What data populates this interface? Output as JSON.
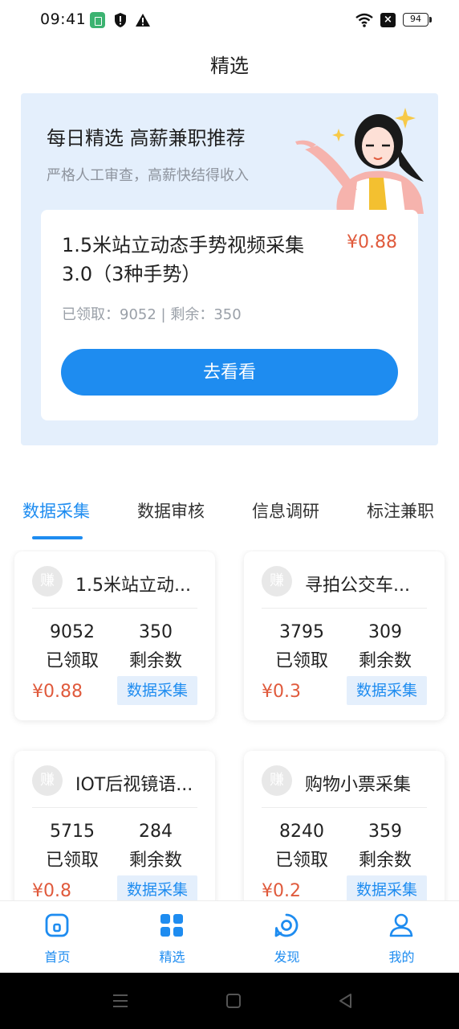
{
  "status_bar": {
    "time": "09:41",
    "battery": "94"
  },
  "page_title": "精选",
  "banner": {
    "title": "每日精选 高薪兼职推荐",
    "subtitle": "严格人工审查，高薪快结得收入",
    "featured_task": {
      "title": "1.5米站立动态手势视频采集3.0（3种手势）",
      "price": "¥0.88",
      "stats": "已领取：9052 | 剩余：350",
      "cta_label": "去看看"
    }
  },
  "tabs": [
    {
      "label": "数据采集",
      "active": true
    },
    {
      "label": "数据审核",
      "active": false
    },
    {
      "label": "信息调研",
      "active": false
    },
    {
      "label": "标注兼职",
      "active": false
    }
  ],
  "cards": [
    {
      "badge": "赚",
      "title": "1.5米站立动...",
      "claimed": "9052",
      "claimed_label": "已领取",
      "remaining": "350",
      "remaining_label": "剩余数",
      "price": "¥0.88",
      "tag": "数据采集"
    },
    {
      "badge": "赚",
      "title": "寻拍公交车...",
      "claimed": "3795",
      "claimed_label": "已领取",
      "remaining": "309",
      "remaining_label": "剩余数",
      "price": "¥0.3",
      "tag": "数据采集"
    },
    {
      "badge": "赚",
      "title": "IOT后视镜语...",
      "claimed": "5715",
      "claimed_label": "已领取",
      "remaining": "284",
      "remaining_label": "剩余数",
      "price": "¥0.8",
      "tag": "数据采集"
    },
    {
      "badge": "赚",
      "title": "购物小票采集",
      "claimed": "8240",
      "claimed_label": "已领取",
      "remaining": "359",
      "remaining_label": "剩余数",
      "price": "¥0.2",
      "tag": "数据采集"
    }
  ],
  "bottom_nav": [
    {
      "label": "首页",
      "icon": "home-icon"
    },
    {
      "label": "精选",
      "icon": "grid-icon"
    },
    {
      "label": "发现",
      "icon": "discover-icon"
    },
    {
      "label": "我的",
      "icon": "profile-icon"
    }
  ],
  "colors": {
    "accent": "#1e8cf0",
    "price": "#e05a3c",
    "banner_bg": "#e4effc"
  }
}
